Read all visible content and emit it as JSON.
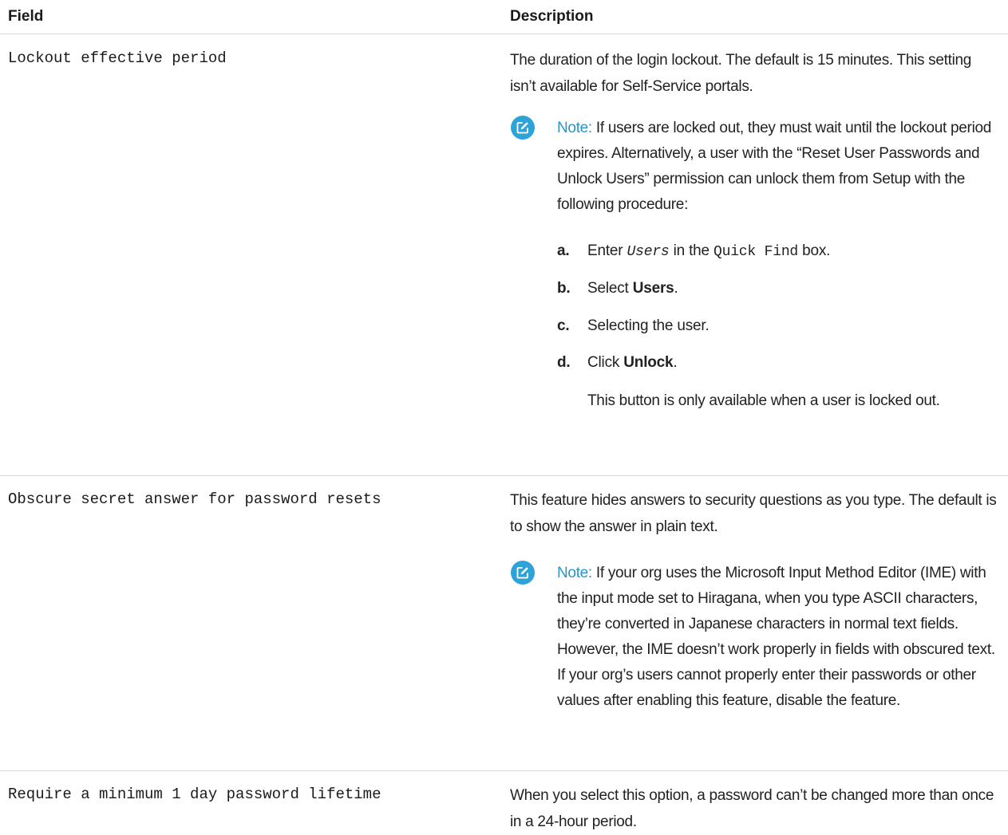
{
  "table": {
    "headers": {
      "field": "Field",
      "description": "Description"
    },
    "rows": [
      {
        "field": "Lockout effective period",
        "description": "The duration of the login lockout. The default is 15 minutes. This setting isn’t available for Self-Service portals.",
        "note": {
          "label": "Note:",
          "text": "If users are locked out, they must wait until the lockout period expires. Alternatively, a user with the “Reset User Passwords and Unlock Users” permission can unlock them from Setup with the following procedure:",
          "steps": [
            {
              "letter": "a.",
              "pre": "Enter",
              "code_italic": "Users",
              "mid": "in the",
              "code": "Quick Find",
              "post": "box."
            },
            {
              "letter": "b.",
              "pre": "Select",
              "bold": "Users",
              "post": "."
            },
            {
              "letter": "c.",
              "text": "Selecting the user."
            },
            {
              "letter": "d.",
              "pre": "Click",
              "bold": "Unlock",
              "post": "."
            }
          ],
          "after_steps": "This button is only available when a user is locked out."
        }
      },
      {
        "field": "Obscure secret answer for password resets",
        "description": "This feature hides answers to security questions as you type. The default is to show the answer in plain text.",
        "note": {
          "label": "Note:",
          "text": "If your org uses the Microsoft Input Method Editor (IME) with the input mode set to Hiragana, when you type ASCII characters, they’re converted in Japanese characters in normal text fields. However, the IME doesn’t work properly in fields with obscured text. If your org’s users cannot properly enter their passwords or other values after enabling this feature, disable the feature."
        }
      },
      {
        "field": "Require a minimum 1 day password lifetime",
        "description": "When you select this option, a password can’t be changed more than once in a 24-hour period."
      }
    ]
  },
  "icons": {
    "note": "edit-note-icon"
  },
  "colors": {
    "note_icon_bg": "#2ea3d8",
    "note_label": "#2a94c9",
    "rule": "#d8d8d8"
  }
}
